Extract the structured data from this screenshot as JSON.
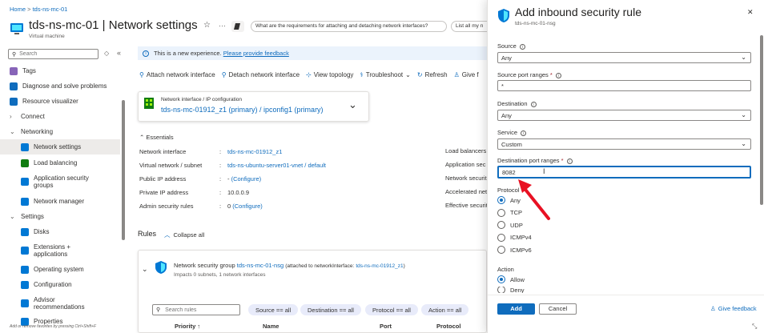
{
  "breadcrumb": {
    "home": "Home",
    "sep": ">",
    "resource": "tds-ns-mc-01"
  },
  "header": {
    "title": "tds-ns-mc-01 | Network settings",
    "subtitle": "Virtual machine",
    "star": "☆",
    "more": "···",
    "copilot_prompt": "What are the requirements for attaching and detaching network interfaces?",
    "copilot_prompt2": "List all my n"
  },
  "sidebar": {
    "search_placeholder": "Search",
    "items": [
      {
        "label": "Tags",
        "color": "#8764b8"
      },
      {
        "label": "Diagnose and solve problems",
        "color": "#0f6cbd"
      },
      {
        "label": "Resource visualizer",
        "color": "#0f6cbd"
      },
      {
        "label": "Connect",
        "chevron": "›"
      },
      {
        "label": "Networking",
        "chevron": "⌄"
      },
      {
        "label": "Network settings",
        "color": "#0078d4"
      },
      {
        "label": "Load balancing",
        "color": "#107c10"
      },
      {
        "label": "Application security groups",
        "color": "#0078d4"
      },
      {
        "label": "Network manager",
        "color": "#0078d4"
      },
      {
        "label": "Settings",
        "chevron": "⌄"
      },
      {
        "label": "Disks",
        "color": "#0078d4"
      },
      {
        "label": "Extensions + applications",
        "color": "#0078d4"
      },
      {
        "label": "Operating system",
        "color": "#0078d4"
      },
      {
        "label": "Configuration",
        "color": "#0078d4"
      },
      {
        "label": "Advisor recommendations",
        "color": "#0078d4"
      },
      {
        "label": "Properties",
        "color": "#0078d4"
      }
    ],
    "footer_hint": "Add or remove favorites by pressing Ctrl+Shift+F"
  },
  "banner": {
    "text": "This is a new experience.",
    "link": "Please provide feedback"
  },
  "toolbar": {
    "attach": "Attach network interface",
    "detach": "Detach network interface",
    "topology": "View topology",
    "troubleshoot": "Troubleshoot",
    "refresh": "Refresh",
    "feedback": "Give f"
  },
  "nic_card": {
    "label": "Network interface / IP configuration",
    "value": "tds-ns-mc-01912_z1 (primary) / ipconfig1 (primary)"
  },
  "essentials": {
    "title": "Essentials",
    "rows": [
      {
        "key": "Network interface",
        "value": "tds-ns-mc-01912_z1",
        "link": true
      },
      {
        "key": "Virtual network / subnet",
        "value": "tds-ns-ubuntu-server01-vnet / default",
        "link": true
      },
      {
        "key": "Public IP address",
        "value": "- (Configure)",
        "link": false
      },
      {
        "key": "Private IP address",
        "value": "10.0.0.9",
        "link": false
      },
      {
        "key": "Admin security rules",
        "value": "0 (Configure)",
        "link": false
      }
    ],
    "right_keys": [
      "Load balancers",
      "Application sec",
      "Network securit",
      "Accelerated net",
      "Effective securit"
    ]
  },
  "rules": {
    "title": "Rules",
    "collapse": "Collapse all"
  },
  "nsg": {
    "prefix": "Network security group",
    "name": "tds-ns-mc-01-nsg",
    "attached": "(attached to networkInterface:",
    "nic": "tds-ns-mc-01912_z1",
    "close": ")",
    "impacts": "Impacts 0 subnets, 1 network interfaces"
  },
  "filters": {
    "search_placeholder": "Search rules",
    "pills": [
      "Source == all",
      "Destination == all",
      "Protocol == all",
      "Action == all"
    ]
  },
  "table": {
    "columns": [
      "Priority ↑",
      "Name",
      "Port",
      "Protocol"
    ]
  },
  "panel": {
    "title": "Add inbound security rule",
    "subtitle": "tds-ns-mc-01-nsg",
    "close": "✕",
    "source_label": "Source",
    "source_value": "Any",
    "src_ports_label": "Source port ranges",
    "src_ports_value": "*",
    "dest_label": "Destination",
    "dest_value": "Any",
    "service_label": "Service",
    "service_value": "Custom",
    "dest_ports_label": "Destination port ranges",
    "dest_ports_value": "8082",
    "protocol_label": "Protocol",
    "protocols": [
      "Any",
      "TCP",
      "UDP",
      "ICMPv4",
      "ICMPv6"
    ],
    "action_label": "Action",
    "actions": [
      "Allow",
      "Deny"
    ],
    "add": "Add",
    "cancel": "Cancel",
    "feedback": "Give feedback",
    "required": "*",
    "accent": "#0f6cbd"
  }
}
